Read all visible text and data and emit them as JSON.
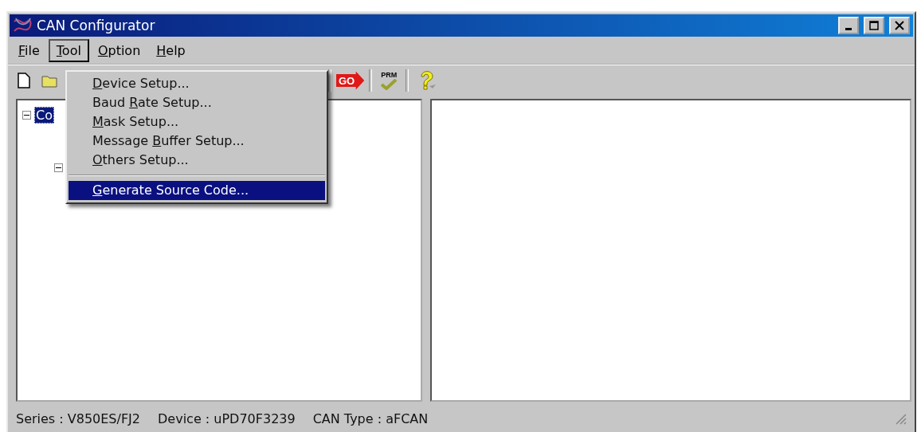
{
  "window": {
    "title": "CAN Configurator"
  },
  "menu_bar": [
    {
      "key": "F",
      "post": "ile",
      "selected": false
    },
    {
      "key": "T",
      "post": "ool",
      "selected": true
    },
    {
      "key": "O",
      "post": "ption",
      "selected": false
    },
    {
      "key": "H",
      "post": "elp",
      "selected": false
    }
  ],
  "tool_menu": [
    {
      "kind": "item",
      "key": "D",
      "post": "evice Setup...",
      "selected": false
    },
    {
      "kind": "item",
      "pre": "Baud ",
      "key": "R",
      "post": "ate Setup...",
      "selected": false
    },
    {
      "kind": "item",
      "key": "M",
      "post": "ask Setup...",
      "selected": false
    },
    {
      "kind": "item",
      "pre": "Message ",
      "key": "B",
      "post": "uffer Setup...",
      "selected": false
    },
    {
      "kind": "item",
      "key": "O",
      "post": "thers Setup...",
      "selected": false
    },
    {
      "kind": "separator"
    },
    {
      "kind": "item",
      "key": "G",
      "post": "enerate Source Code...",
      "selected": true
    }
  ],
  "toolbar": [
    {
      "kind": "new"
    },
    {
      "kind": "open"
    },
    {
      "kind": "go",
      "label": "GO"
    },
    {
      "kind": "prm",
      "label": "PRM"
    },
    {
      "kind": "help"
    }
  ],
  "tree": {
    "label": "Co",
    "selected": true,
    "expanded": true,
    "children": [
      {
        "expanded": true
      }
    ]
  },
  "status_bar": [
    "Series : V850ES/FJ2",
    "Device : uPD70F3239",
    "CAN Type : aFCAN"
  ]
}
